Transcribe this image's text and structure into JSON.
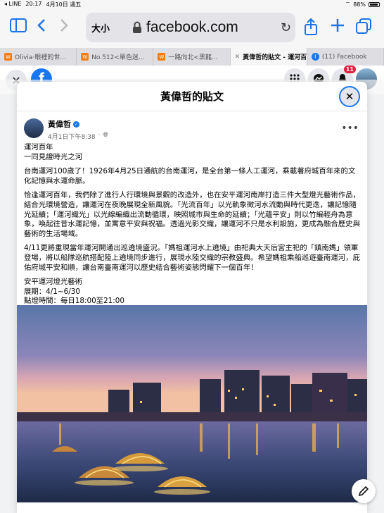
{
  "status": {
    "carrier": "◂ LINE",
    "time": "20:17",
    "date": "4月10日 週五",
    "battery": "88%"
  },
  "browser": {
    "text_size": "大小",
    "url": "facebook.com"
  },
  "tabs": [
    {
      "label": "Olivia‧眼裡的世...",
      "icon": "orange",
      "glyph": "W"
    },
    {
      "label": "No.512<單色迷...",
      "icon": "orange",
      "glyph": "W"
    },
    {
      "label": "一路向北<黑龍...",
      "icon": "orange",
      "glyph": "W"
    },
    {
      "label": "黃偉哲的貼文 - 運河百...",
      "icon": "close",
      "glyph": "✕"
    },
    {
      "label": "(11) Facebook",
      "icon": "fb",
      "glyph": "f"
    }
  ],
  "fb_nav": {
    "notifications_count": "11"
  },
  "modal": {
    "title": "黃偉哲的貼文"
  },
  "post": {
    "author": "黃偉哲",
    "timestamp": "4月1日下午8:38",
    "paragraphs": [
      "運河百年\n一同見證時光之河",
      "台南運河100歲了！1926年4月25日通航的台南運河，是全台第一條人工運河，乘載著府城百年來的文化記憶與水運命脈。",
      "恰逢運河百年，我們除了進行人行環境與景觀的改造外，也在安平運河南岸打造三件大型燈光藝術作品，結合光環境營造，讓運河在夜晚展現全新風貌。「光流百年」以光軌象徵河水流動與時代更迭，讓記憶隨光延續；「運河織光」以光線編織出流動循環，映照城市與生命的延續；「光蘊平安」則以竹編輕舟為意象，喚起往昔水運記憶，並寓意平安與祝福。透過光影交織，讓運河不只是水利設施，更成為融合歷史與藝術的生活場域。",
      "4/11更將重現當年運河開通出巡遶境盛況。「媽祖運河水上遶境」由祀典大天后宮主祀的「鎮南媽」領軍登場，將以船隊巡航搭配陸上遶境同步進行，展現水陸交織的宗教盛典。希望媽祖乘船巡遊臺南運河，庇佑府城平安和順，讓台南臺南運河以歷史結合藝術姿態閃耀下一個百年！",
      "安平運河燈光藝術\n展期：4/1~6/30\n點燈時間：每日18:00至21:00"
    ]
  }
}
